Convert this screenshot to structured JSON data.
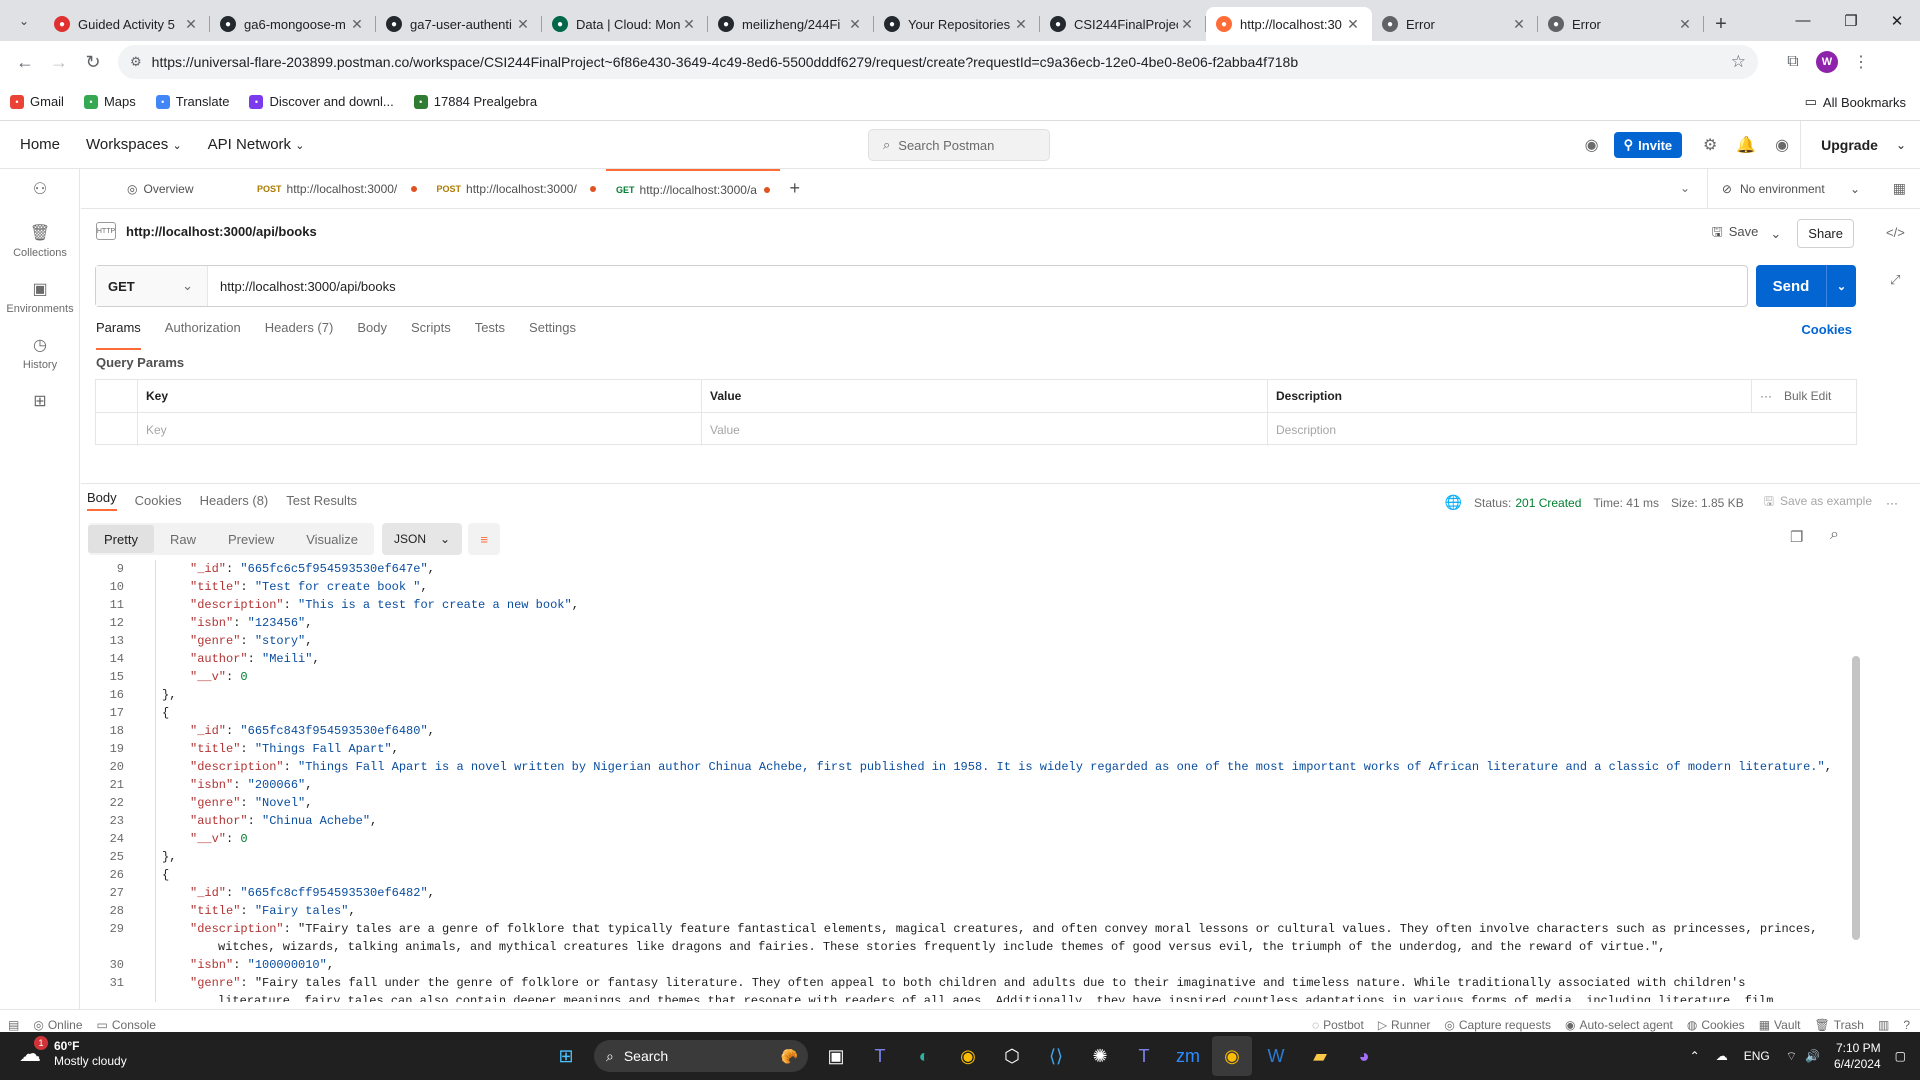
{
  "browser": {
    "tabs": [
      {
        "title": "Guided Activity 5",
        "icon": "target-icon",
        "color": "#e03030"
      },
      {
        "title": "ga6-mongoose-m",
        "icon": "github-icon",
        "color": "#24292f"
      },
      {
        "title": "ga7-user-authenti",
        "icon": "github-icon",
        "color": "#24292f"
      },
      {
        "title": "Data | Cloud: Mon",
        "icon": "mongodb-icon",
        "color": "#00684a"
      },
      {
        "title": "meilizheng/244Fi",
        "icon": "github-icon",
        "color": "#24292f"
      },
      {
        "title": "Your Repositories",
        "icon": "github-icon",
        "color": "#24292f"
      },
      {
        "title": "CSI244FinalProjec",
        "icon": "github-icon",
        "color": "#24292f"
      },
      {
        "title": "http://localhost:30",
        "icon": "postman-icon",
        "color": "#ff6c37"
      },
      {
        "title": "Error",
        "icon": "globe-icon",
        "color": "#5f6368"
      },
      {
        "title": "Error",
        "icon": "globe-icon",
        "color": "#5f6368"
      }
    ],
    "active_tab": 7,
    "address": "https://universal-flare-203899.postman.co/workspace/CSI244FinalProject~6f86e430-3649-4c49-8ed6-5500dddf6279/request/create?requestId=c9a36ecb-12e0-4be0-8e06-f2abba4f718b",
    "profile_initial": "W",
    "bookmarks": [
      {
        "label": "Gmail",
        "color": "#ea4335"
      },
      {
        "label": "Maps",
        "color": "#34a853"
      },
      {
        "label": "Translate",
        "color": "#4285f4"
      },
      {
        "label": "Discover and downl...",
        "color": "#7c3aed"
      },
      {
        "label": "17884 Prealgebra",
        "color": "#2e7d32"
      }
    ],
    "all_bookmarks": "All Bookmarks"
  },
  "postman": {
    "nav": [
      "Home",
      "Workspaces",
      "API Network"
    ],
    "search_placeholder": "Search Postman",
    "invite": "Invite",
    "upgrade": "Upgrade",
    "sidebar": [
      "Collections",
      "Environments",
      "History"
    ],
    "req_tabs": [
      {
        "label": "Overview",
        "method": ""
      },
      {
        "label": "http://localhost:3000/",
        "method": "POST"
      },
      {
        "label": "http://localhost:3000/",
        "method": "POST"
      },
      {
        "label": "http://localhost:3000/a",
        "method": "GET"
      }
    ],
    "environment": "No environment",
    "request_name": "http://localhost:3000/api/books",
    "save": "Save",
    "share": "Share",
    "method": "GET",
    "url": "http://localhost:3000/api/books",
    "send": "Send",
    "request_tabs": [
      "Params",
      "Authorization",
      "Headers (7)",
      "Body",
      "Scripts",
      "Tests",
      "Settings"
    ],
    "cookies": "Cookies",
    "query_params_title": "Query Params",
    "params_headers": {
      "key": "Key",
      "value": "Value",
      "description": "Description",
      "bulk": "Bulk Edit"
    },
    "params_placeholders": {
      "key": "Key",
      "value": "Value",
      "description": "Description"
    },
    "response_tabs": [
      "Body",
      "Cookies",
      "Headers (8)",
      "Test Results"
    ],
    "status_label": "Status:",
    "status": "201 Created",
    "time": "Time: 41 ms",
    "size": "Size: 1.85 KB",
    "save_example": "Save as example",
    "view_modes": [
      "Pretty",
      "Raw",
      "Preview",
      "Visualize"
    ],
    "format": "JSON",
    "code_lines": [
      {
        "n": "9",
        "indent": 3,
        "text": "\"_id\": \"665fc6c5f954593530ef647e\","
      },
      {
        "n": "10",
        "indent": 3,
        "text": "\"title\": \"Test for create book \","
      },
      {
        "n": "11",
        "indent": 3,
        "text": "\"description\": \"This is a test for create a new book\","
      },
      {
        "n": "12",
        "indent": 3,
        "text": "\"isbn\": \"123456\","
      },
      {
        "n": "13",
        "indent": 3,
        "text": "\"genre\": \"story\","
      },
      {
        "n": "14",
        "indent": 3,
        "text": "\"author\": \"Meili\","
      },
      {
        "n": "15",
        "indent": 3,
        "text": "\"__v\": 0"
      },
      {
        "n": "16",
        "indent": 2,
        "text": "},"
      },
      {
        "n": "17",
        "indent": 2,
        "text": "{"
      },
      {
        "n": "18",
        "indent": 3,
        "text": "\"_id\": \"665fc843f954593530ef6480\","
      },
      {
        "n": "19",
        "indent": 3,
        "text": "\"title\": \"Things Fall Apart\","
      },
      {
        "n": "20",
        "indent": 3,
        "text": "\"description\": \"Things Fall Apart is a novel written by Nigerian author Chinua Achebe, first published in 1958. It is widely regarded as one of the most important works of African literature and a classic of modern literature.\","
      },
      {
        "n": "21",
        "indent": 3,
        "text": "\"isbn\": \"200066\","
      },
      {
        "n": "22",
        "indent": 3,
        "text": "\"genre\": \"Novel\","
      },
      {
        "n": "23",
        "indent": 3,
        "text": "\"author\": \"Chinua Achebe\","
      },
      {
        "n": "24",
        "indent": 3,
        "text": "\"__v\": 0"
      },
      {
        "n": "25",
        "indent": 2,
        "text": "},"
      },
      {
        "n": "26",
        "indent": 2,
        "text": "{"
      },
      {
        "n": "27",
        "indent": 3,
        "text": "\"_id\": \"665fc8cff954593530ef6482\","
      },
      {
        "n": "28",
        "indent": 3,
        "text": "\"title\": \"Fairy tales\","
      },
      {
        "n": "29",
        "indent": 3,
        "text": "\"description\": \"TFairy tales are a genre of folklore that typically feature fantastical elements, magical creatures, and often convey moral lessons or cultural values. They often involve characters such as princesses, princes,"
      },
      {
        "n": "",
        "indent": 4,
        "text": "witches, wizards, talking animals, and mythical creatures like dragons and fairies. These stories frequently include themes of good versus evil, the triumph of the underdog, and the reward of virtue.\","
      },
      {
        "n": "30",
        "indent": 3,
        "text": "\"isbn\": \"100000010\","
      },
      {
        "n": "31",
        "indent": 3,
        "text": "\"genre\": \"Fairy tales fall under the genre of folklore or fantasy literature. They often appeal to both children and adults due to their imaginative and timeless nature. While traditionally associated with children's"
      },
      {
        "n": "",
        "indent": 4,
        "text": "literature, fairy tales can also contain deeper meanings and themes that resonate with readers of all ages. Additionally, they have inspired countless adaptations in various forms of media, including literature, film,"
      }
    ],
    "status_bar_left": [
      "Online",
      "Console"
    ],
    "status_bar_right": [
      "Postbot",
      "Runner",
      "Capture requests",
      "Auto-select agent",
      "Cookies",
      "Vault",
      "Trash"
    ]
  },
  "taskbar": {
    "temp": "60°F",
    "weather": "Mostly cloudy",
    "badge": "1",
    "search": "Search",
    "lang": "ENG",
    "time": "7:10 PM",
    "date": "6/4/2024"
  }
}
